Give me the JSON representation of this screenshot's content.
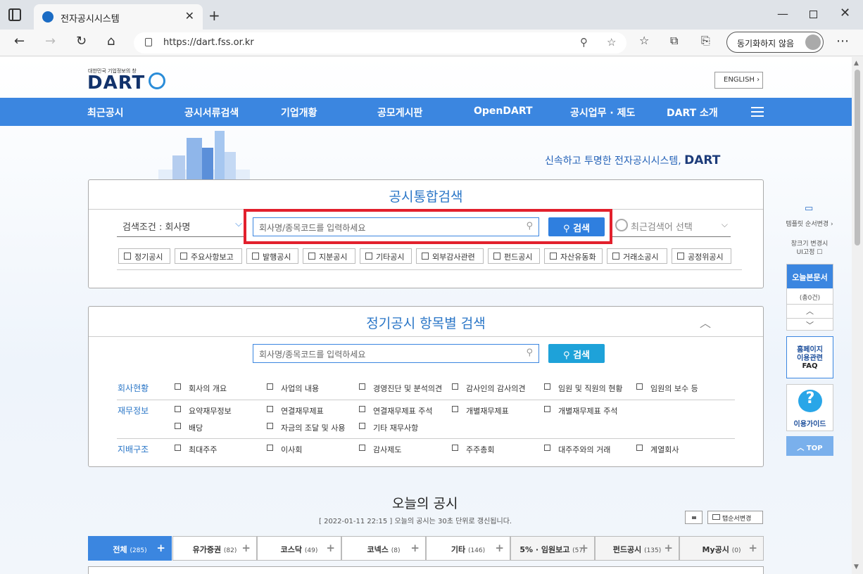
{
  "browser": {
    "tab_title": "전자공시시스템",
    "url": "https://dart.fss.or.kr",
    "sync_label": "동기화하지 않음"
  },
  "header": {
    "logo_small": "대한민국 기업정보의 창",
    "logo": "DART",
    "english_btn": "ENGLISH ›"
  },
  "menu": [
    "최근공시",
    "공시서류검색",
    "기업개황",
    "공모게시판",
    "OpenDART",
    "공시업무 · 제도",
    "DART 소개"
  ],
  "slogan": {
    "text": "신속하고 투명한 전자공시시스템,",
    "brand": "DART"
  },
  "search": {
    "title": "공시통합검색",
    "condition": "검색조건 : 회사명",
    "placeholder": "회사명/종목코드를 입력하세요",
    "button": "검색",
    "recent": "최근검색어 선택",
    "chips": [
      "정기공시",
      "주요사항보고",
      "발행공시",
      "지분공시",
      "기타공시",
      "외부감사관련",
      "펀드공시",
      "자산유동화",
      "거래소공시",
      "공정위공시"
    ]
  },
  "periodic": {
    "title": "정기공시 항목별 검색",
    "placeholder": "회사명/종목코드를 입력하세요",
    "button": "검색",
    "rows": [
      {
        "label": "회사현황",
        "options": [
          "회사의 개요",
          "사업의 내용",
          "경영진단 및 분석의견",
          "감사인의 감사의견",
          "임원 및 직원의 현황",
          "임원의 보수 등"
        ]
      },
      {
        "label": "재무정보",
        "options": [
          "요약재무정보",
          "연결재무제표",
          "연결재무제표 주석",
          "개별재무제표",
          "개별재무제표 주석",
          "배당",
          "자금의 조달 및 사용",
          "기타 재무사항"
        ]
      },
      {
        "label": "지배구조",
        "options": [
          "최대주주",
          "이사회",
          "감사제도",
          "주주총회",
          "대주주와의 거래",
          "계열회사"
        ]
      }
    ]
  },
  "sidebar": {
    "template_label": "템플릿 순서변경 ›",
    "fix_label_1": "창크기 변경시",
    "fix_label_2": "UI고정",
    "today_docs": "오늘본문서",
    "today_count": "(총0건)",
    "faq_1": "홈페이지",
    "faq_2": "이용관련",
    "faq_3": "FAQ",
    "guide": "이용가이드",
    "top": "TOP"
  },
  "today": {
    "title": "오늘의 공시",
    "subtitle": "[ 2022-01-11 22:15 ] 오늘의 공시는 30초 단위로 갱신됩니다.",
    "view_toggle": "탭순서변경",
    "tabs": [
      {
        "label": "전체",
        "count": "(285)"
      },
      {
        "label": "유가증권",
        "count": "(82)"
      },
      {
        "label": "코스닥",
        "count": "(49)"
      },
      {
        "label": "코넥스",
        "count": "(8)"
      },
      {
        "label": "기타",
        "count": "(146)"
      },
      {
        "label": "5% · 임원보고",
        "count": "(57)"
      },
      {
        "label": "펀드공시",
        "count": "(135)"
      },
      {
        "label": "My공시",
        "count": "(0)"
      }
    ]
  }
}
